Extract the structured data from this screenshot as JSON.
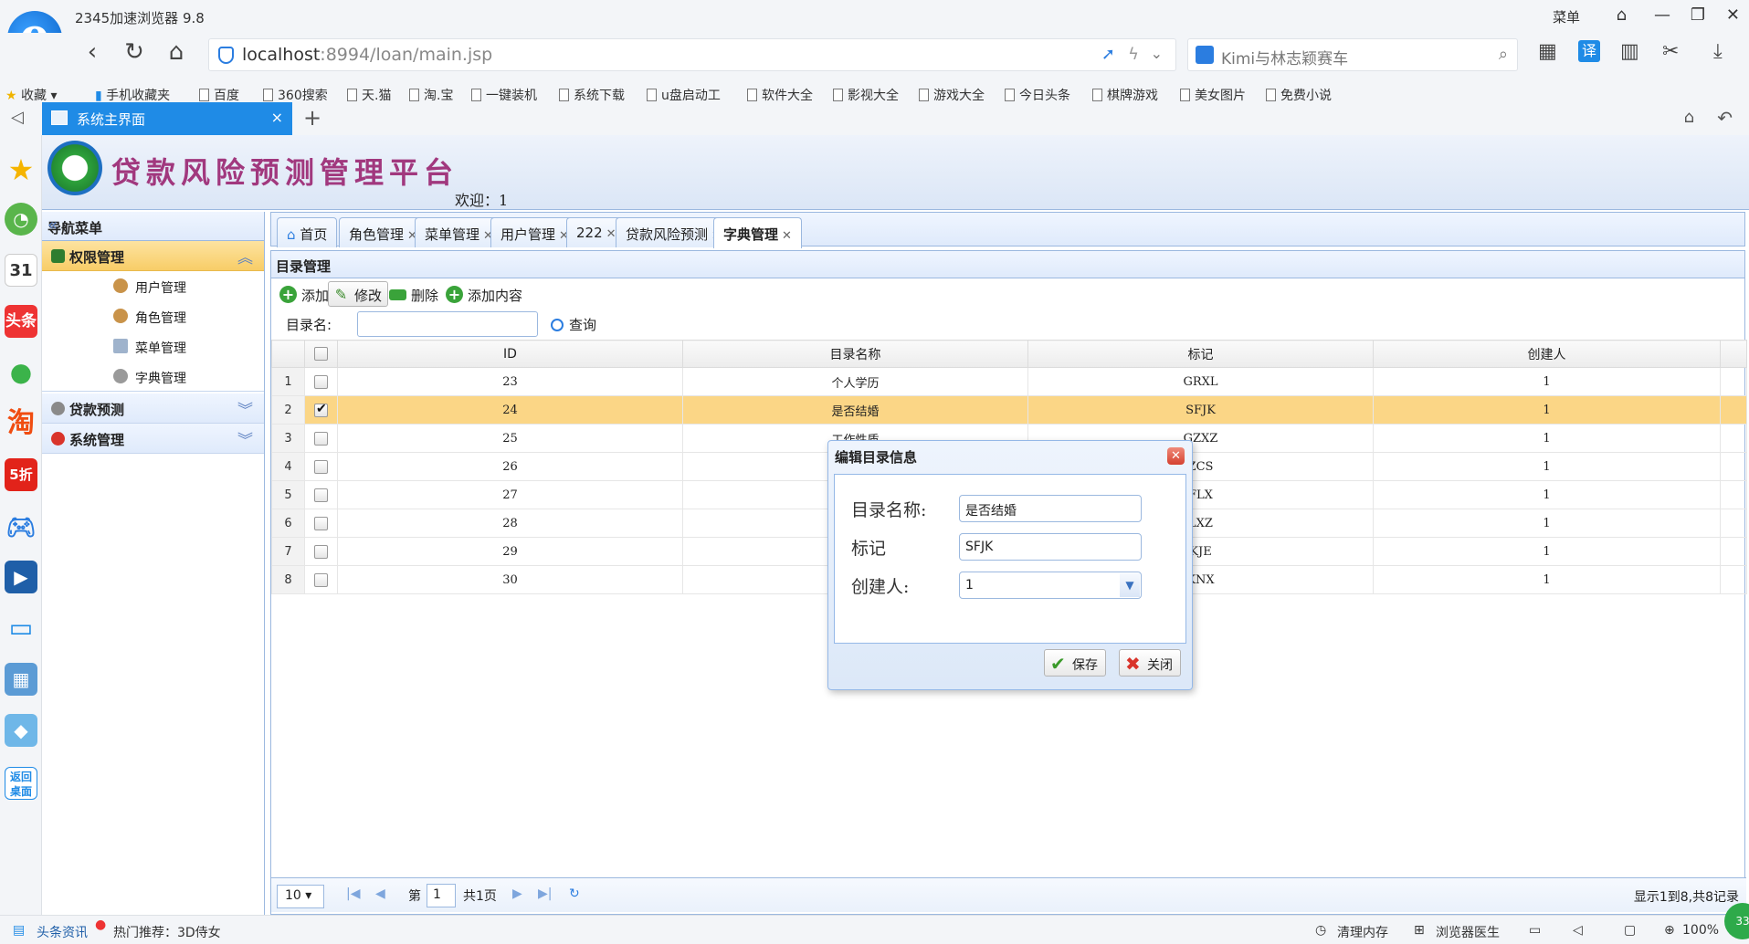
{
  "browser": {
    "title": "2345加速浏览器 9.8",
    "menu_label": "菜单",
    "url_host": "localhost",
    "url_rest": ":8994/loan/main.jsp",
    "search_text": "Kimi与林志颖赛车",
    "bookmarks": [
      "收藏",
      "手机收藏夹",
      "百度",
      "360搜索",
      "天.猫",
      "淘.宝",
      "一键装机",
      "系统下载",
      "u盘启动工",
      "软件大全",
      "影视大全",
      "游戏大全",
      "今日头条",
      "棋牌游戏",
      "美女图片",
      "免费小说"
    ],
    "tab_label": "系统主界面",
    "tab_close": "×",
    "new_tab": "+"
  },
  "side_apps": {
    "calendar_day": "31",
    "toutiao": "头条",
    "taobao": "淘",
    "discount": "5折",
    "return_desktop": "返回桌面"
  },
  "site": {
    "title": "贷款风险预测管理平台",
    "welcome": "欢迎：1"
  },
  "nav": {
    "header": "导航菜单",
    "groups": [
      {
        "label": "权限管理",
        "items": [
          "用户管理",
          "角色管理",
          "菜单管理",
          "字典管理"
        ]
      },
      {
        "label": "贷款预测"
      },
      {
        "label": "系统管理"
      }
    ]
  },
  "content_tabs": [
    {
      "label": "首页"
    },
    {
      "label": "角色管理"
    },
    {
      "label": "菜单管理"
    },
    {
      "label": "用户管理"
    },
    {
      "label": "222"
    },
    {
      "label": "贷款风险预测"
    },
    {
      "label": "字典管理"
    }
  ],
  "panel": {
    "title": "目录管理",
    "toolbar": {
      "add": "添加",
      "edit": "修改",
      "delete": "删除",
      "add_content": "添加内容"
    },
    "search": {
      "label": "目录名:",
      "value": "",
      "button": "查询"
    }
  },
  "grid": {
    "columns": [
      "ID",
      "目录名称",
      "标记",
      "创建人"
    ],
    "rows": [
      {
        "n": "1",
        "id": "23",
        "name": "个人学历",
        "mark": "GRXL",
        "creator": "1",
        "checked": false
      },
      {
        "n": "2",
        "id": "24",
        "name": "是否结婚",
        "mark": "SFJK",
        "creator": "1",
        "checked": true
      },
      {
        "n": "3",
        "id": "25",
        "name": "工作性质",
        "mark": "GZXZ",
        "creator": "1",
        "checked": false
      },
      {
        "n": "4",
        "id": "26",
        "name": "",
        "mark": "ZCS",
        "creator": "1",
        "checked": false
      },
      {
        "n": "5",
        "id": "27",
        "name": "",
        "mark": "FLX",
        "creator": "1",
        "checked": false
      },
      {
        "n": "6",
        "id": "28",
        "name": "",
        "mark": "LXZ",
        "creator": "1",
        "checked": false
      },
      {
        "n": "7",
        "id": "29",
        "name": "",
        "mark": "KJE",
        "creator": "1",
        "checked": false
      },
      {
        "n": "8",
        "id": "30",
        "name": "",
        "mark": "KNX",
        "creator": "1",
        "checked": false
      }
    ]
  },
  "pager": {
    "page_size": "10",
    "page_prefix": "第",
    "page_number": "1",
    "page_total": "共1页",
    "info": "显示1到8,共8记录"
  },
  "dialog": {
    "title": "编辑目录信息",
    "name_label": "目录名称:",
    "name_value": "是否结婚",
    "mark_label": "标记",
    "mark_value": "SFJK",
    "creator_label": "创建人:",
    "creator_value": "1",
    "save": "保存",
    "close": "关闭"
  },
  "statusbar": {
    "news": "头条资讯",
    "hot": "热门推荐：3D侍女",
    "clean": "清理内存",
    "doctor": "浏览器医生",
    "zoom": "100%",
    "badge": "33"
  }
}
